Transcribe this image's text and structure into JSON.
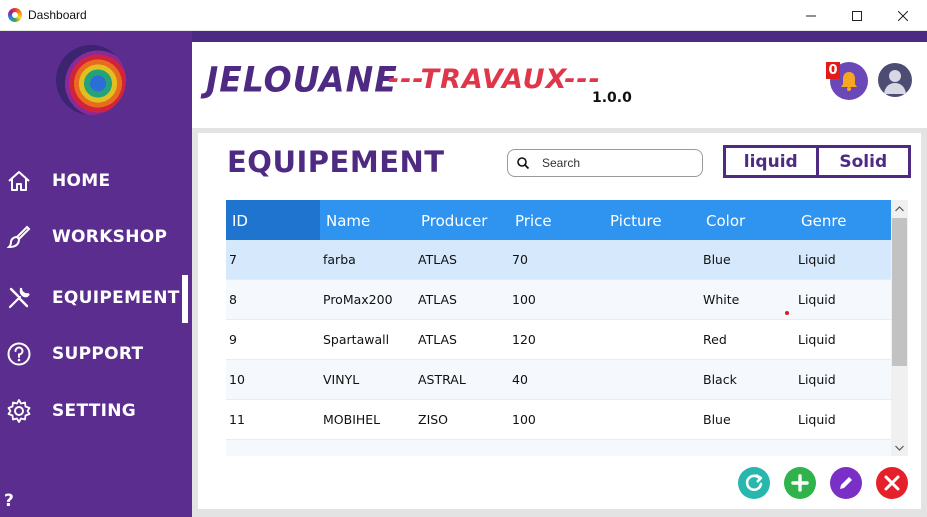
{
  "window": {
    "title": "Dashboard",
    "minimize": "—",
    "maximize": "☐",
    "close": "✕"
  },
  "sidebar": {
    "items": [
      {
        "label": "HOME",
        "icon": "home-icon"
      },
      {
        "label": "WORKSHOP",
        "icon": "paintbrush-icon"
      },
      {
        "label": "EQUIPEMENT",
        "icon": "tools-icon",
        "active": true
      },
      {
        "label": "SUPPORT",
        "icon": "help-circle-icon"
      },
      {
        "label": "SETTING",
        "icon": "gear-icon"
      }
    ],
    "help": "?"
  },
  "header": {
    "brand": "JELOUANE",
    "brand_sub": "---TRAVAUX---",
    "version": "1.0.0",
    "notification_count": "0"
  },
  "main": {
    "title": "EQUIPEMENT",
    "search_placeholder": "Search",
    "filters": [
      "liquid",
      "Solid"
    ]
  },
  "table": {
    "columns": [
      "ID",
      "Name",
      "Producer",
      "Price",
      "Picture",
      "Color",
      "Genre"
    ],
    "rows": [
      [
        "7",
        "farba",
        "ATLAS",
        "70",
        "",
        "Blue",
        "Liquid"
      ],
      [
        "8",
        "ProMax200",
        "ATLAS",
        "100",
        "",
        "White",
        "Liquid"
      ],
      [
        "9",
        "Spartawall",
        "ATLAS",
        "120",
        "",
        "Red",
        "Liquid"
      ],
      [
        "10",
        "VINYL",
        "ASTRAL",
        "40",
        "",
        "Black",
        "Liquid"
      ],
      [
        "11",
        "MOBIHEL",
        "ZISO",
        "100",
        "",
        "Blue",
        "Liquid"
      ]
    ],
    "selected_row": 0
  },
  "colors": {
    "sidebar": "#5a2d8f",
    "accent": "#4e2a83",
    "table_header": "#2f93f0",
    "brand_sub": "#e0364a"
  },
  "actions": [
    "refresh-icon",
    "plus-icon",
    "pencil-icon",
    "close-icon"
  ]
}
